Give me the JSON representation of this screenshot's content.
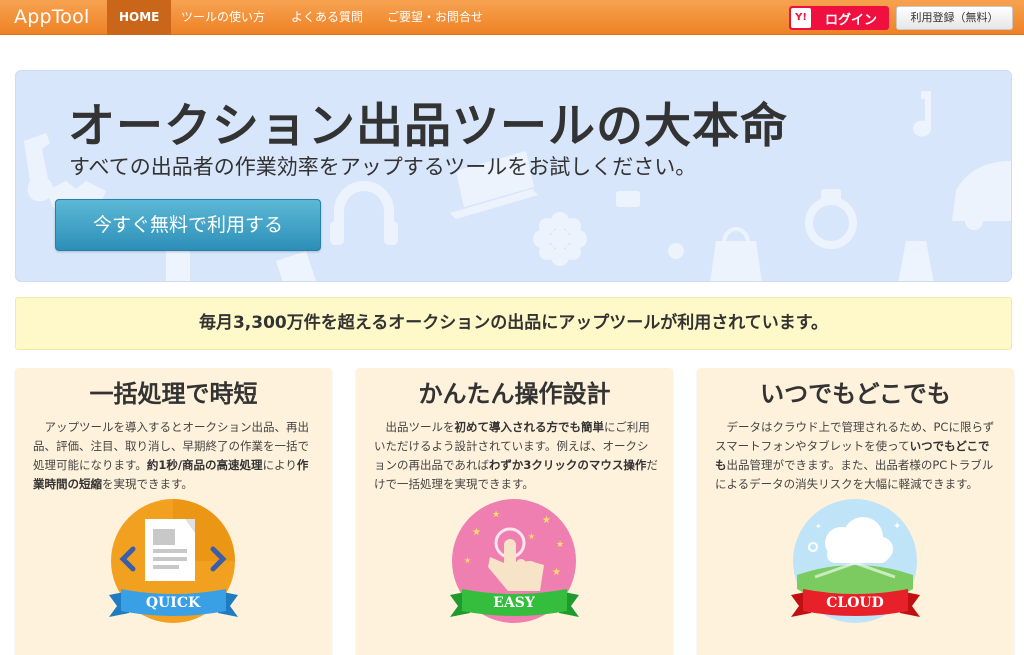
{
  "navbar": {
    "brand": "AppTool",
    "items": [
      "HOME",
      "ツールの使い方",
      "よくある質問",
      "ご要望・お問合せ"
    ],
    "login": {
      "icon": "Y!",
      "label": "ログイン"
    },
    "register": "利用登録（無料）",
    "colors": {
      "bar": "#ee8226",
      "active": "#c9661a",
      "login": "#f01040"
    }
  },
  "hero": {
    "title": "オークション出品ツールの大本命",
    "subtitle": "すべての出品者の作業効率をアップするツールをお試しください。",
    "cta": "今すぐ無料で利用する"
  },
  "banner": "毎月3,300万件を超えるオークションの出品にアップツールが利用されています。",
  "features": [
    {
      "title": "一括処理で時短",
      "text_parts": [
        "アップツールを導入するとオークション出品、再出品、評価、注目、取り消し、早期終了の作業を一括で処理可能になります。",
        "約1秒/商品の高速処理",
        "により",
        "作業時間の短縮",
        "を実現できます。"
      ],
      "badge_label": "QUICK",
      "icon": "document-arrows-icon",
      "color": "#f2a020"
    },
    {
      "title": "かんたん操作設計",
      "text_parts": [
        "出品ツールを",
        "初めて導入される方でも簡単",
        "にご利用いただけるよう設計されています。例えば、オークションの再出品であれば",
        "わずか3クリックのマウス操作",
        "だけで一括処理を実現できます。"
      ],
      "badge_label": "EASY",
      "icon": "tap-hand-icon",
      "color": "#ef7fb0"
    },
    {
      "title": "いつでもどこでも",
      "text_parts": [
        "データはクラウド上で管理されるため、PCに限らずスマートフォンやタブレットを使って",
        "いつでもどこでも",
        "出品管理ができます。また、出品者様のPCトラブルによるデータの消失リスクを大幅に軽減できます。"
      ],
      "badge_label": "CLOUD",
      "icon": "cloud-icon",
      "color": "#7ec6ee"
    }
  ]
}
